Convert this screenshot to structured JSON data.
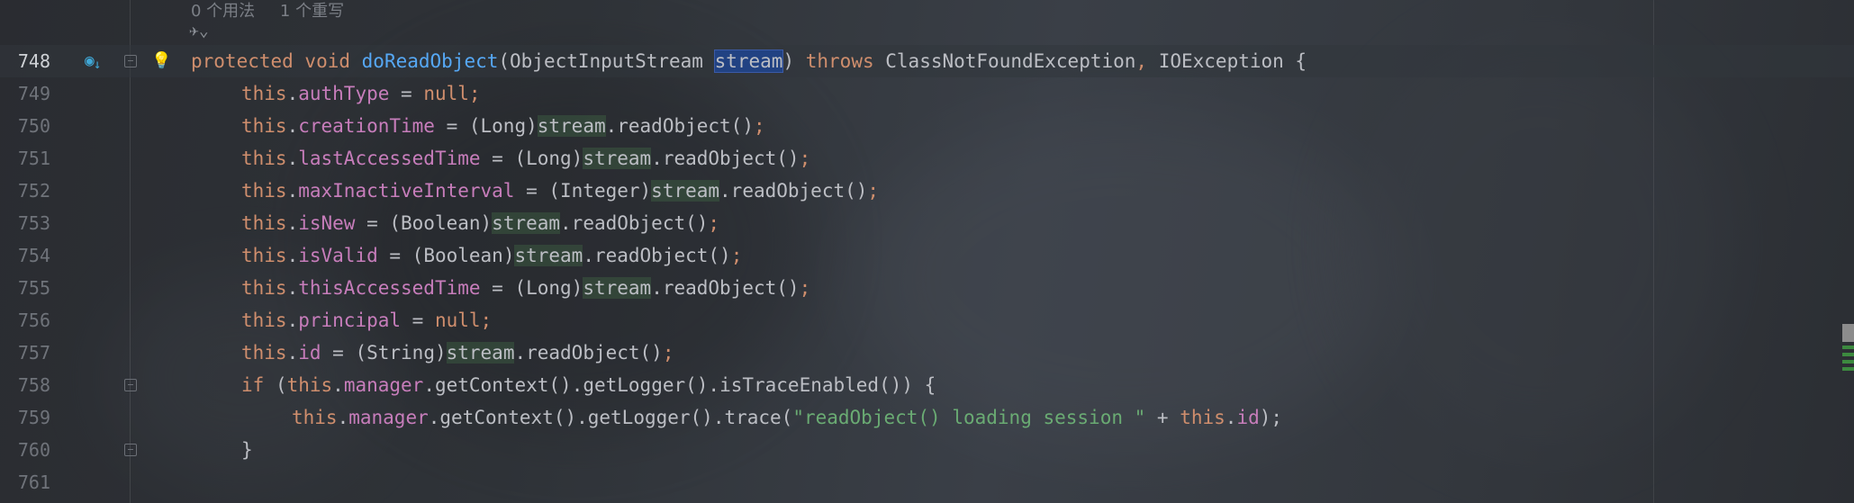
{
  "hints": {
    "usages": "0 个用法",
    "overrides": "1 个重写",
    "ai_hint_icon": "✈⌄"
  },
  "gutter": {
    "bookmark_icon": "override-method-icon",
    "bulb_icon": "bulb-icon"
  },
  "lines": [
    {
      "num": "748",
      "current": true
    },
    {
      "num": "749"
    },
    {
      "num": "750"
    },
    {
      "num": "751"
    },
    {
      "num": "752"
    },
    {
      "num": "753"
    },
    {
      "num": "754"
    },
    {
      "num": "755"
    },
    {
      "num": "756"
    },
    {
      "num": "757"
    },
    {
      "num": "758"
    },
    {
      "num": "759"
    },
    {
      "num": "760"
    },
    {
      "num": "761"
    }
  ],
  "code": {
    "l748": {
      "kw1": "protected void ",
      "fn": "doReadObject",
      "p1": "(ObjectInputStream ",
      "sel": "stream",
      "p2": ") ",
      "kw2": "throws ",
      "t1": "ClassNotFoundException",
      "comma": ", ",
      "t2": "IOException {"
    },
    "l749": {
      "this": "this",
      "dot": ".",
      "fld": "authType",
      "eq": " = ",
      "kw": "null",
      "semi": ";"
    },
    "l750": {
      "this": "this",
      "dot": ".",
      "fld": "creationTime",
      "eq": " = (Long)",
      "ref": "stream",
      "call": ".readObject()",
      "semi": ";"
    },
    "l751": {
      "this": "this",
      "dot": ".",
      "fld": "lastAccessedTime",
      "eq": " = (Long)",
      "ref": "stream",
      "call": ".readObject()",
      "semi": ";"
    },
    "l752": {
      "this": "this",
      "dot": ".",
      "fld": "maxInactiveInterval",
      "eq": " = (Integer)",
      "ref": "stream",
      "call": ".readObject()",
      "semi": ";"
    },
    "l753": {
      "this": "this",
      "dot": ".",
      "fld": "isNew",
      "eq": " = (Boolean)",
      "ref": "stream",
      "call": ".readObject()",
      "semi": ";"
    },
    "l754": {
      "this": "this",
      "dot": ".",
      "fld": "isValid",
      "eq": " = (Boolean)",
      "ref": "stream",
      "call": ".readObject()",
      "semi": ";"
    },
    "l755": {
      "this": "this",
      "dot": ".",
      "fld": "thisAccessedTime",
      "eq": " = (Long)",
      "ref": "stream",
      "call": ".readObject()",
      "semi": ";"
    },
    "l756": {
      "this": "this",
      "dot": ".",
      "fld": "principal",
      "eq": " = ",
      "kw": "null",
      "semi": ";"
    },
    "l757": {
      "this": "this",
      "dot": ".",
      "fld": "id",
      "eq": " = (String)",
      "ref": "stream",
      "call": ".readObject()",
      "semi": ";"
    },
    "l758": {
      "kwif": "if ",
      "p": "(",
      "this": "this",
      "dot": ".",
      "fld": "manager",
      "rest": ".getContext().getLogger().isTraceEnabled()) {"
    },
    "l759": {
      "this": "this",
      "dot": ".",
      "fld": "manager",
      "mid": ".getContext().getLogger().trace(",
      "str": "\"readObject() loading session \"",
      "plus": " + ",
      "this2": "this",
      "dot2": ".",
      "fld2": "id",
      "end": ");"
    },
    "l760": {
      "brace": "}"
    }
  }
}
